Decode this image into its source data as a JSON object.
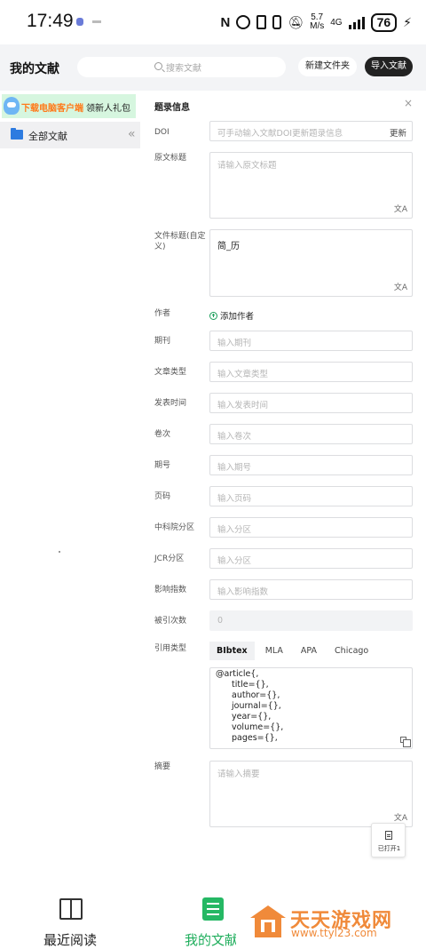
{
  "status_bar": {
    "time": "17:49",
    "net_speed_top": "5.7",
    "net_speed_bottom": "M/s",
    "network": "4G",
    "battery": "76"
  },
  "header": {
    "title": "我的文献",
    "search_placeholder": "搜索文献",
    "new_folder": "新建文件夹",
    "import": "导入文献"
  },
  "sidebar": {
    "promo_highlight": "下载电脑客户端",
    "promo_text": "领新人礼包",
    "all_docs": "全部文献",
    "collapse_icon": "«"
  },
  "panel": {
    "title": "题录信息",
    "close_icon": "×",
    "doi": {
      "label": "DOI",
      "placeholder": "可手动输入文献DOI更新题录信息",
      "update": "更新"
    },
    "orig_title": {
      "label": "原文标题",
      "placeholder": "请输入原文标题"
    },
    "file_title": {
      "label_line1": "文件标题(自定",
      "label_line2": "义)",
      "value": "简_历"
    },
    "author": {
      "label": "作者",
      "add": "添加作者"
    },
    "journal": {
      "label": "期刊",
      "placeholder": "输入期刊"
    },
    "article_type": {
      "label": "文章类型",
      "placeholder": "输入文章类型"
    },
    "publish_time": {
      "label": "发表时间",
      "placeholder": "输入发表时间"
    },
    "volume": {
      "label": "卷次",
      "placeholder": "输入卷次"
    },
    "issue": {
      "label": "期号",
      "placeholder": "输入期号"
    },
    "pages": {
      "label": "页码",
      "placeholder": "输入页码"
    },
    "cas": {
      "label": "中科院分区",
      "placeholder": "输入分区"
    },
    "jcr": {
      "label": "JCR分区",
      "placeholder": "输入分区"
    },
    "impact": {
      "label": "影响指数",
      "placeholder": "输入影响指数"
    },
    "citations": {
      "label": "被引次数",
      "value": "0"
    },
    "cite_type": {
      "label": "引用类型",
      "tabs": [
        "BIbtex",
        "MLA",
        "APA",
        "Chicago"
      ],
      "active": 0,
      "lines": [
        "@article{,",
        "title={},",
        "author={},",
        "journal={},",
        "year={},",
        "volume={},",
        "pages={},"
      ]
    },
    "abstract": {
      "label": "摘要",
      "placeholder": "请输入摘要"
    },
    "translate_icon": "文A"
  },
  "opened_button": {
    "label": "已打开1"
  },
  "bottom_nav": {
    "recent": "最近阅读",
    "mine": "我的文献"
  },
  "watermark": {
    "line1": "天天游戏网",
    "line2": "www.ttyl23.com"
  },
  "colors": {
    "accent_green": "#25b864",
    "promo_orange": "#ff7a1a",
    "folder_blue": "#2d7be0"
  }
}
